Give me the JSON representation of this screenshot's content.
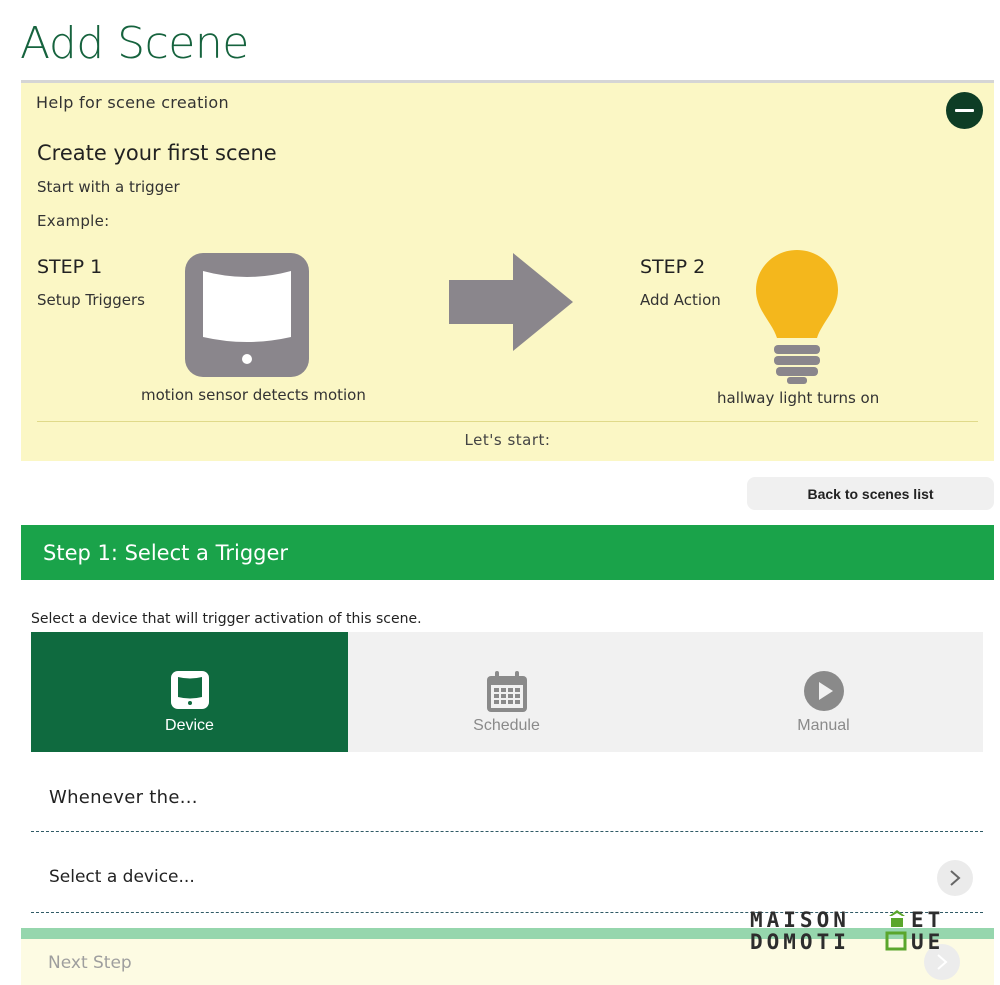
{
  "page": {
    "title": "Add Scene"
  },
  "help": {
    "header": "Help for scene creation",
    "heading": "Create your first scene",
    "subheading": "Start with a trigger",
    "example_label": "Example:",
    "step1": {
      "title": "STEP 1",
      "desc": "Setup Triggers",
      "caption": "motion sensor detects motion"
    },
    "step2": {
      "title": "STEP 2",
      "desc": "Add Action",
      "caption": "hallway light turns on"
    },
    "lets_start": "Let's start:"
  },
  "actions": {
    "back_label": "Back to scenes list"
  },
  "step": {
    "title": "Step 1: Select a Trigger",
    "hint": "Select a device that will trigger activation of this scene."
  },
  "trigger_tabs": [
    {
      "label": "Device",
      "icon": "device-icon",
      "active": true
    },
    {
      "label": "Schedule",
      "icon": "calendar-icon",
      "active": false
    },
    {
      "label": "Manual",
      "icon": "play-icon",
      "active": false
    }
  ],
  "form": {
    "whenever": "Whenever the...",
    "select_device": "Select a device..."
  },
  "footer": {
    "next_step": "Next Step"
  },
  "watermark": {
    "line1": "MAISON ET",
    "line2": "DOMOTIQUE"
  },
  "colors": {
    "title_green": "#16633e",
    "step_bar": "#1aa34a",
    "active_tab": "#0f6a3f",
    "help_bg": "#fbf7c5",
    "bulb": "#f4b71c",
    "illustration_gray": "#8a868c"
  }
}
